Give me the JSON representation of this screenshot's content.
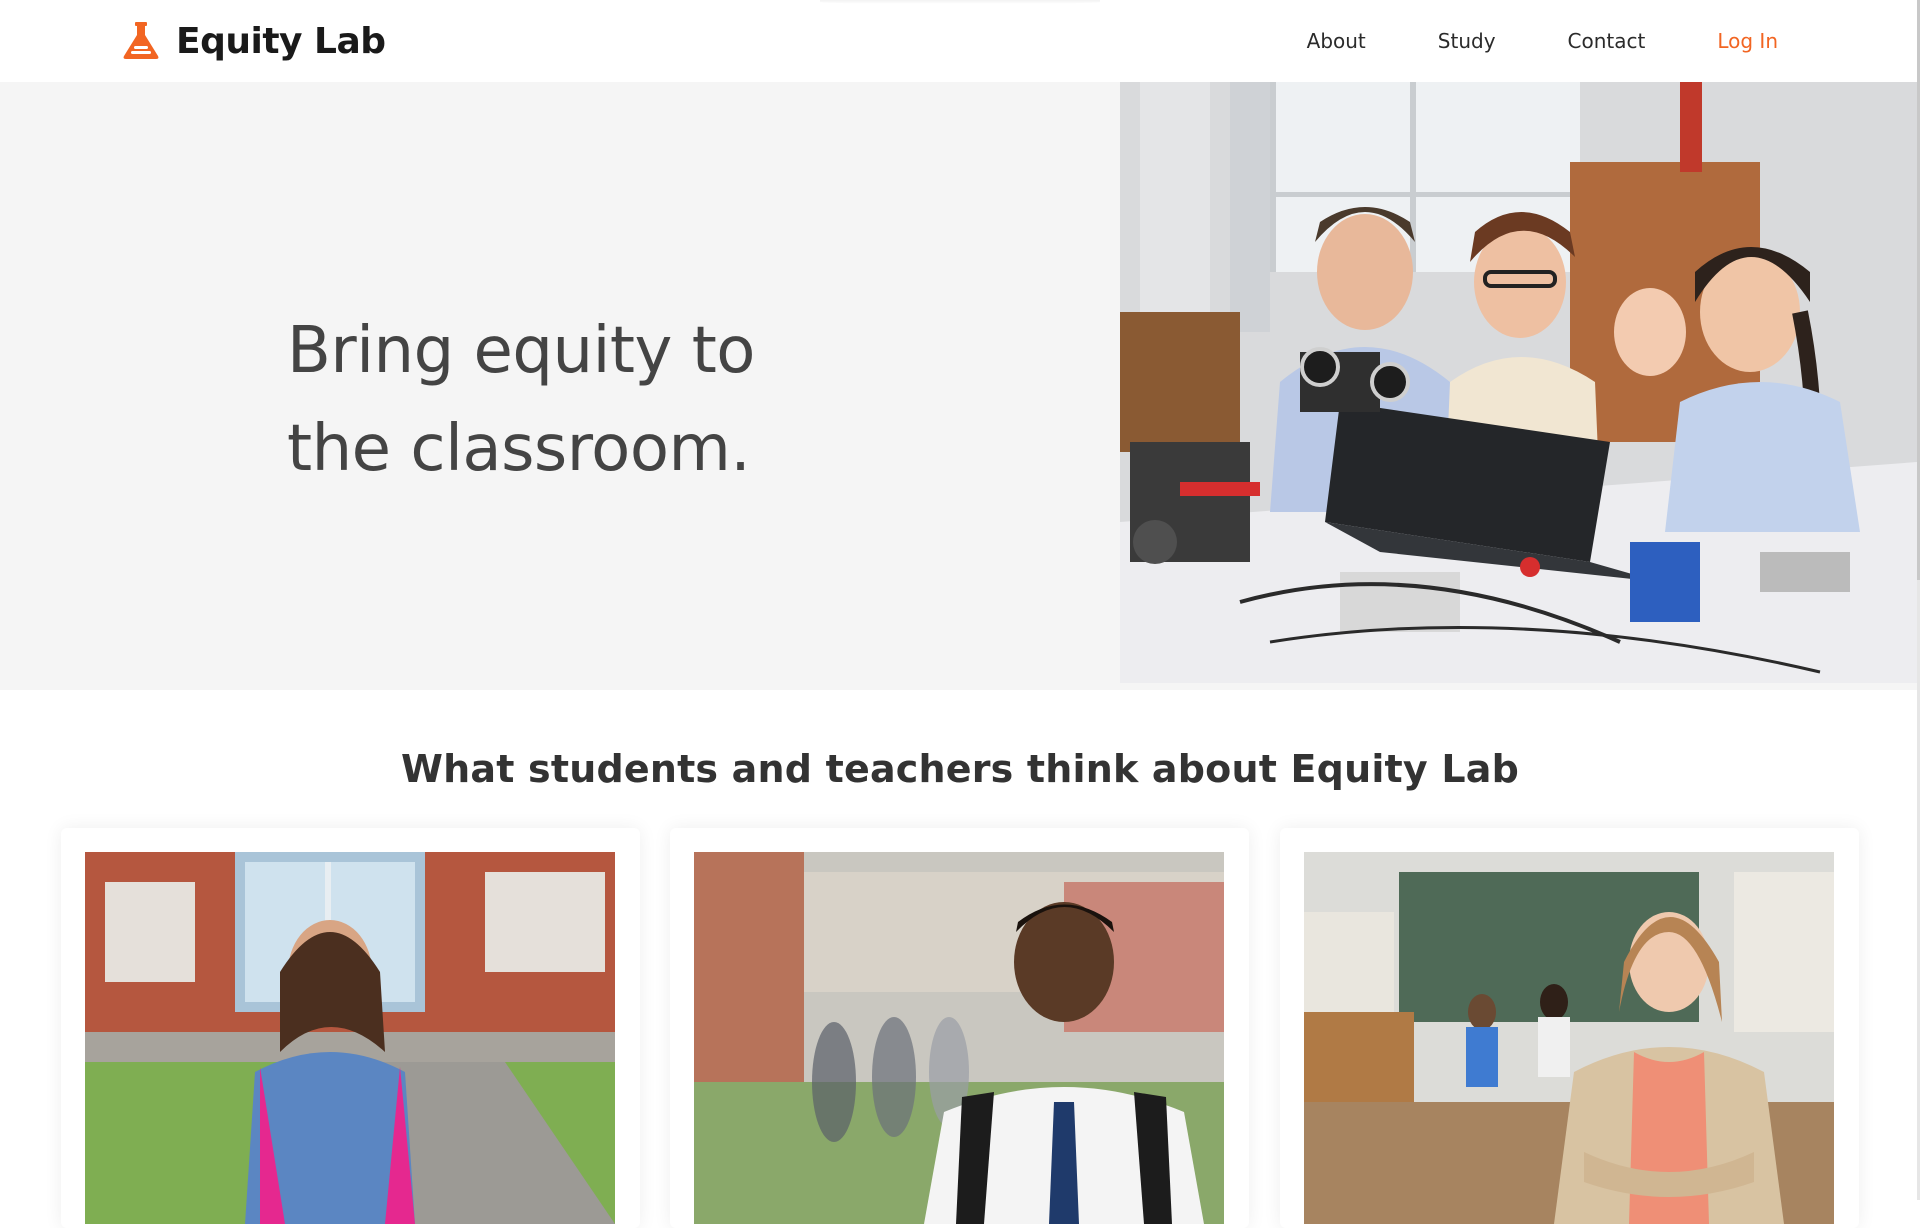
{
  "brand": {
    "name": "Equity Lab",
    "logo_icon": "flask-icon",
    "accent_color": "#f26522"
  },
  "nav": {
    "items": [
      {
        "label": "About"
      },
      {
        "label": "Study"
      },
      {
        "label": "Contact"
      }
    ],
    "login_label": "Log In"
  },
  "hero": {
    "headline_line1": "Bring equity to",
    "headline_line2": "the classroom.",
    "image": "students-and-teacher-building-robots-photo",
    "background": "#f5f5f5"
  },
  "testimonials": {
    "title": "What students and teachers think about Equity Lab",
    "cards": [
      {
        "photo": "girl-with-pink-backpack-photo"
      },
      {
        "photo": "smiling-student-with-backpack-photo"
      },
      {
        "photo": "teacher-in-classroom-photo"
      }
    ]
  }
}
